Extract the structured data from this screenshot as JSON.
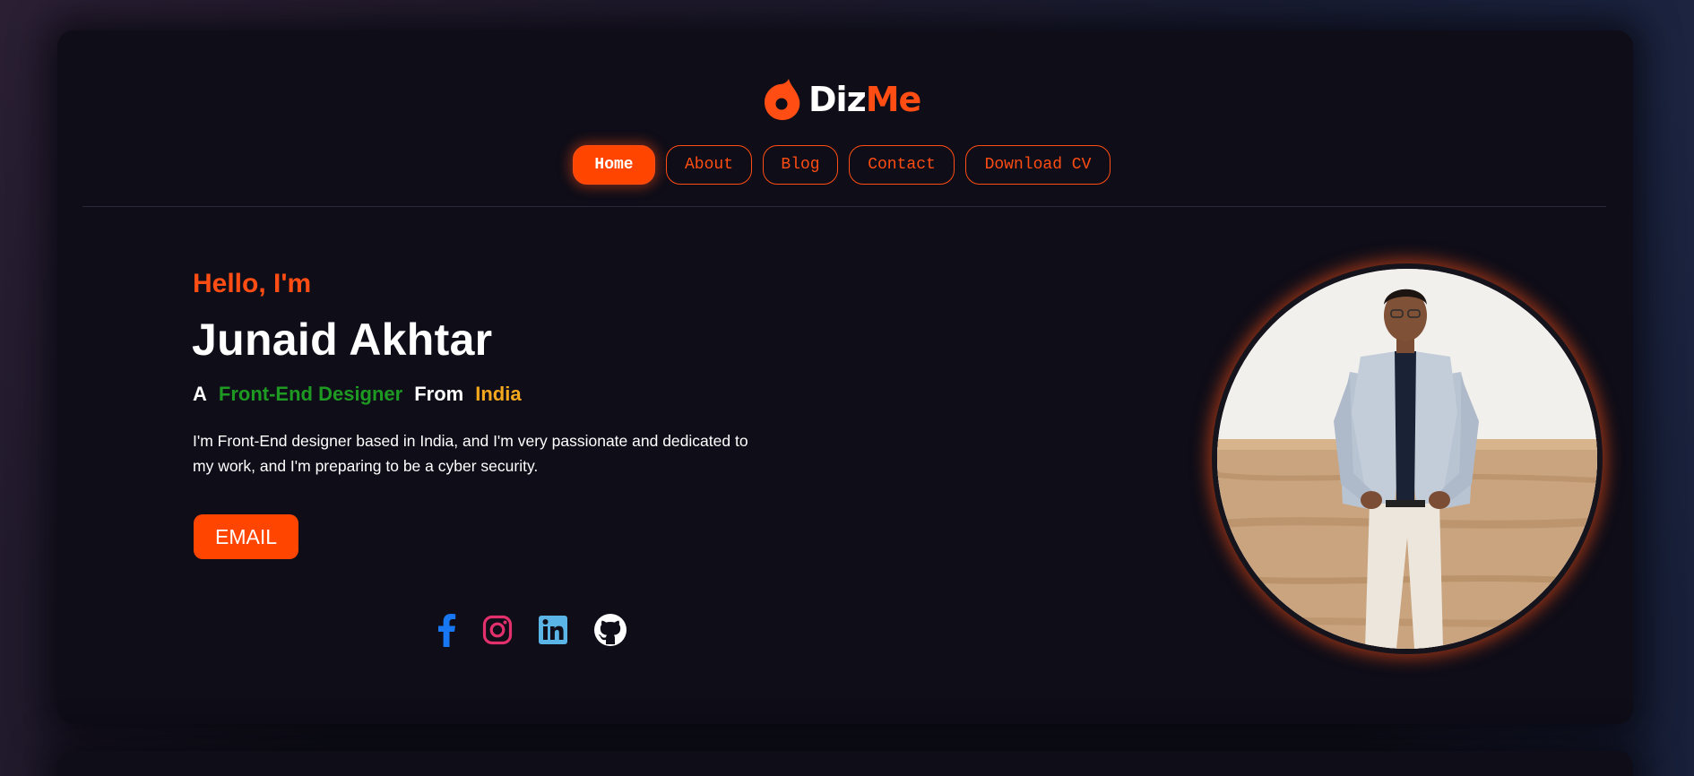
{
  "brand": {
    "name_part1": "Diz",
    "name_part2": "Me",
    "accent_color": "#ff4d13",
    "logo_icon": "flame-drop-icon"
  },
  "nav": {
    "items": [
      {
        "label": "Home",
        "active": true
      },
      {
        "label": "About",
        "active": false
      },
      {
        "label": "Blog",
        "active": false
      },
      {
        "label": "Contact",
        "active": false
      },
      {
        "label": "Download CV",
        "active": false
      }
    ]
  },
  "hero": {
    "greeting": "Hello, I'm",
    "name": "Junaid Akhtar",
    "tagline": {
      "prefix": "A",
      "role": "Front-End Designer",
      "middle": "From",
      "country": "India"
    },
    "description": "I'm Front-End designer based in India, and I'm very passionate and dedicated to my work, and I'm preparing to be a cyber security.",
    "email_button": "EMAIL"
  },
  "social": [
    {
      "icon": "facebook-icon",
      "color": "#1877f2"
    },
    {
      "icon": "instagram-icon",
      "color": "#e1306c"
    },
    {
      "icon": "linkedin-icon",
      "color": "#5ab4e5"
    },
    {
      "icon": "github-icon",
      "color": "#ffffff"
    }
  ],
  "colors": {
    "background": "#0e0d18",
    "accent": "#ff4d13",
    "role_green": "#1e9a23",
    "country_yellow": "#f4a81d"
  }
}
